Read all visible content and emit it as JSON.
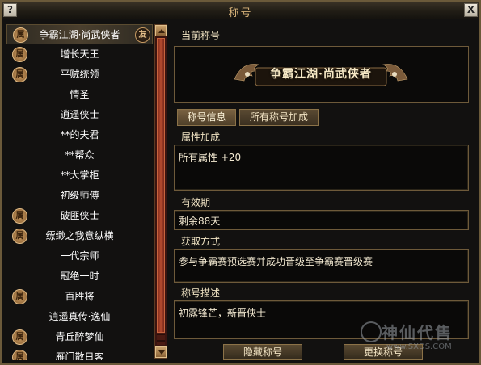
{
  "window": {
    "title": "称号",
    "help_label": "?",
    "close_label": "X"
  },
  "list": {
    "items": [
      {
        "label": "争霸江湖·尚武侠者",
        "badge": "属",
        "badge_right": "友",
        "selected": true
      },
      {
        "label": "增长天王",
        "badge": "属"
      },
      {
        "label": "平贼统领",
        "badge": "属"
      },
      {
        "label": "情圣",
        "badge": ""
      },
      {
        "label": "逍遥侠士",
        "badge": ""
      },
      {
        "label": "**的夫君",
        "badge": ""
      },
      {
        "label": "**帮众",
        "badge": ""
      },
      {
        "label": "**大掌柜",
        "badge": ""
      },
      {
        "label": "初级师傅",
        "badge": ""
      },
      {
        "label": "破匪侠士",
        "badge": "属"
      },
      {
        "label": "缥缈之我意纵横",
        "badge": "属"
      },
      {
        "label": "一代宗师",
        "badge": ""
      },
      {
        "label": "冠绝一时",
        "badge": ""
      },
      {
        "label": "百胜将",
        "badge": "属"
      },
      {
        "label": "逍遥真传·逸仙",
        "badge": ""
      },
      {
        "label": "青丘醉梦仙",
        "badge": "属"
      },
      {
        "label": "雁门散日客",
        "badge": "属"
      }
    ]
  },
  "current": {
    "label": "当前称号",
    "emblem_text": "争霸江湖·尚武侠者"
  },
  "tabs": {
    "info": "称号信息",
    "all_bonus": "所有称号加成"
  },
  "attr": {
    "label": "属性加成",
    "value": "所有属性 +20"
  },
  "validity": {
    "label": "有效期",
    "value": "剩余88天"
  },
  "obtain": {
    "label": "获取方式",
    "value": "参与争霸赛预选赛并成功晋级至争霸赛晋级赛"
  },
  "desc": {
    "label": "称号描述",
    "value": "初露锋芒，新晋侠士"
  },
  "buttons": {
    "hide": "隐藏称号",
    "change": "更换称号"
  },
  "watermark": {
    "text": "神仙代售",
    "url": "www.SXDS.COM"
  },
  "colors": {
    "accent": "#d8b37a",
    "badge": "#c79a62",
    "border": "#6e5a3a",
    "scroll": "#b54b2f"
  }
}
